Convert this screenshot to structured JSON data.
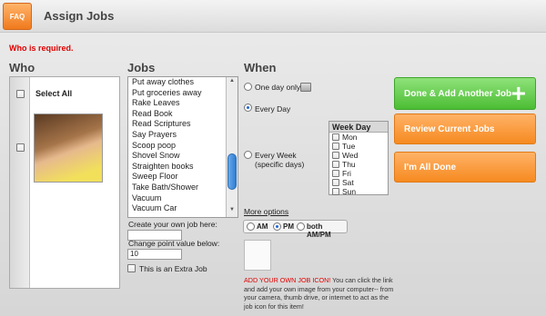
{
  "header": {
    "faq_label": "FAQ",
    "title": "Assign Jobs"
  },
  "error": "Who is required.",
  "who": {
    "title": "Who",
    "select_all_label": "Select All",
    "members": [
      {
        "photo": "child-photo",
        "checked": false
      }
    ]
  },
  "jobs": {
    "title": "Jobs",
    "items": [
      "Put away clothes",
      "Put groceries away",
      "Rake Leaves",
      "Read Book",
      "Read Scriptures",
      "Say Prayers",
      "Scoop poop",
      "Shovel Snow",
      "Straighten books",
      "Sweep Floor",
      "Take Bath/Shower",
      "Vacuum",
      "Vacuum Car"
    ],
    "create_label": "Create your own job here:",
    "create_value": "",
    "points_label": "Change point value below:",
    "points_value": "10",
    "extra_job_label": "This is an Extra Job"
  },
  "when": {
    "title": "When",
    "one_day_label": "One day only",
    "every_day_label": "Every Day",
    "every_week_label": "Every Week",
    "every_week_sub": "(specific days)",
    "selected_frequency": "Every Day",
    "weekday_header": "Week Day",
    "weekdays": [
      "Mon",
      "Tue",
      "Wed",
      "Thu",
      "Fri",
      "Sat",
      "Sun"
    ],
    "more_options_label": "More options",
    "am_label": "AM",
    "pm_label": "PM",
    "both_label": "both AM/PM",
    "selected_period": "PM",
    "add_icon_red": "ADD YOUR OWN JOB ICON!",
    "add_icon_text": " You can click the link and add your own image from your computer-- from your camera, thumb drive, or internet to act as the job icon for this item!"
  },
  "buttons": {
    "done_add": "Done & Add Another Job",
    "review": "Review Current Jobs",
    "all_done": "I'm All Done"
  },
  "colors": {
    "green": "#4cbd34",
    "orange": "#f68a20",
    "error_red": "#e00000",
    "scroll_blue": "#2f7fd4"
  }
}
